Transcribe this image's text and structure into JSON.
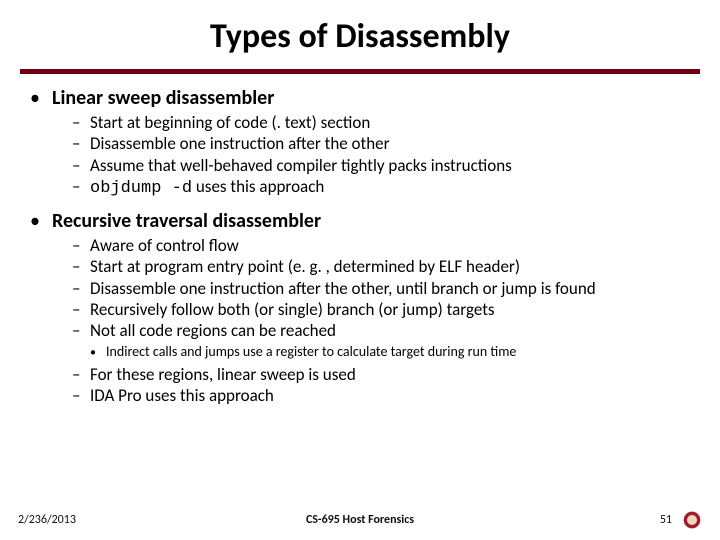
{
  "title": "Types of Disassembly",
  "sections": [
    {
      "heading": "Linear sweep disassembler",
      "items": [
        {
          "text": "Start at beginning of code (. text) section"
        },
        {
          "text": "Disassemble one instruction after the other"
        },
        {
          "text": "Assume that well-behaved compiler tightly packs instructions"
        },
        {
          "prefix": "objdump -d",
          "text": " uses this approach",
          "mono": true
        }
      ]
    },
    {
      "heading": "Recursive traversal disassembler",
      "items": [
        {
          "text": "Aware of control flow"
        },
        {
          "text": "Start at program entry point (e. g. , determined by ELF header)"
        },
        {
          "text": "Disassemble one instruction after the other, until branch or jump is found"
        },
        {
          "text": "Recursively follow both (or single) branch (or jump) targets"
        },
        {
          "text": "Not all code regions can be reached"
        }
      ],
      "sub": [
        {
          "text": "Indirect calls and jumps use a register to calculate target during run time"
        }
      ],
      "tail": [
        {
          "text": "For these regions, linear sweep is used"
        },
        {
          "text": "IDA Pro uses this approach"
        }
      ]
    }
  ],
  "footer": {
    "date": "2/236/2013",
    "center": "CS-695 Host Forensics",
    "page": "51"
  },
  "bullets": {
    "dot": "•",
    "dash": "–"
  }
}
